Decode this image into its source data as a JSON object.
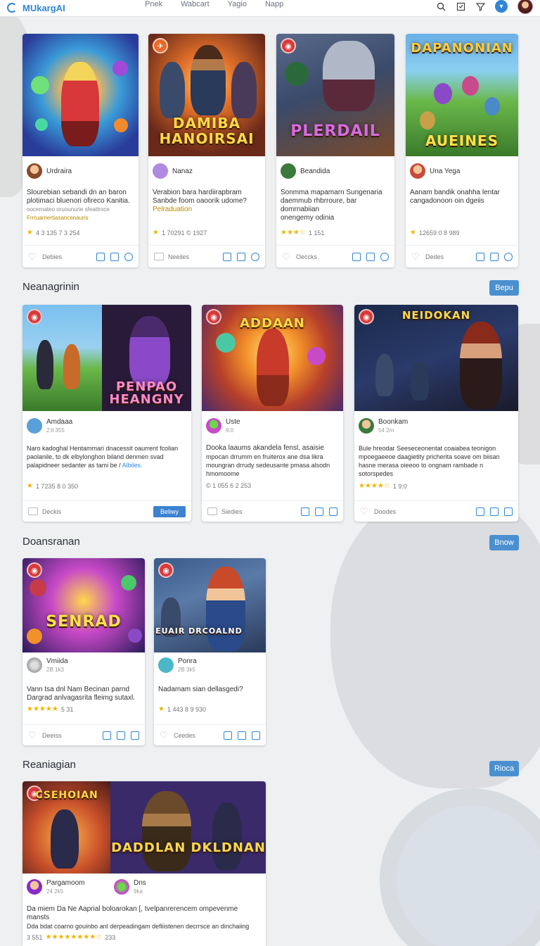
{
  "header": {
    "logo_text": "MUkargAI",
    "nav": [
      "Pnek",
      "Wabcart",
      "Yagio",
      "Napp"
    ],
    "icons": [
      "search-icon",
      "bookmark-icon",
      "filter-icon",
      "chevron-down-icon"
    ]
  },
  "featured": {
    "cards": [
      {
        "thumb_title": "",
        "author": "Urdraira",
        "desc": [
          "Slourebian sebandi dn an baron",
          "plotimaci bluenori ofireco Kanitia."
        ],
        "desc_extra": "oocernateo oruounurie sfeattroce",
        "desc_hl": "Frrruarnertiasancenauris",
        "stats": "4 3 135  7 3 254",
        "foot": "Debies"
      },
      {
        "thumb_title": "DAMIBA HANOIRSAI",
        "author": "Nanaz",
        "desc": [
          "Verabion bara hardiirapbram",
          "Sanbde foom oaoorik udome?"
        ],
        "desc_hl": "Pelraduation",
        "stats": "1 70291  ©  1927",
        "foot": "Neeiles"
      },
      {
        "thumb_title": "PLERDAIL",
        "author": "Beandida",
        "desc": [
          "Sonmma mapamarn Sungenaria",
          "daemmub rhbrroure, bar domrnabiian",
          "onengemy odinia"
        ],
        "stats": "1 151",
        "foot": "Oeccks"
      },
      {
        "thumb_title": "DAPANONIAN",
        "thumb_sub": "AUEINES",
        "author": "Una Yega",
        "desc": [
          "Aanam bandik onahha lentar",
          "cangadonoon oin dgeiis"
        ],
        "stats": "12659 0  8  989",
        "foot": "Dedes"
      }
    ]
  },
  "sections": [
    {
      "title": "Neanagrinin",
      "more": "Bepu",
      "cards": [
        {
          "thumb_title": "PENPAO HEANGNY",
          "author": "Amdaaa",
          "author_sub": "2:ll 355",
          "desc": [
            "Naro kadoghal Hentammari dnacessit oaurrent fcolian",
            "paolanile, to dk elbylonghon biland denmen svad",
            "palapidneer sedanter as tami be / "
          ],
          "desc_link": "Albiles.",
          "stats": "1 7235  8  0 350",
          "foot": "Deckis",
          "play": "Beliwy"
        },
        {
          "thumb_title": "ADDAAN",
          "author": "Uste",
          "author_sub": "9:0",
          "desc": [
            "Dooka laaums akandela fensl, asaisie",
            "mpocan drrumm en fruiterox ane dsa likra",
            "moungran drrudy sedeusante pmasa alsodn",
            "hmomoome"
          ],
          "stats": "© 1 055  6  2 253",
          "foot": "Siedies"
        },
        {
          "thumb_title": "NEIDOKAN",
          "author": "Boonkam",
          "author_sub": "54 2m",
          "desc": [
            "Bule hreodar Seeseceonentat coaiabea teonigon",
            "mpoegaeeoe daagietity pricherita soave om biisan",
            "hasne merasa oieeoo to ongnam rambade n",
            "sotorspedes"
          ],
          "stats": "1 9:0",
          "foot": "Doodes"
        }
      ]
    },
    {
      "title": "Doansranan",
      "more": "Bnow",
      "cards": [
        {
          "thumb_title": "SENRAD",
          "author": "Vmiida",
          "author_sub": "2B 1k3",
          "desc": [
            "Vann tsa dnl Nam Becinan parnd",
            "Dargrad anlvagasrita fleimg sutaxl."
          ],
          "stats": "5 31",
          "foot": "Deeiss"
        },
        {
          "thumb_title": "SEUAIR DRCOALND",
          "author": "Ponra",
          "author_sub": "2B 3k5",
          "desc": [
            "Nadamam sian dellasgedi?"
          ],
          "stats": "1 443  8  9  930",
          "foot": "Ceedes"
        }
      ]
    },
    {
      "title": "Reaniagian",
      "more": "Rioca",
      "cards": [
        {
          "thumb_title": "CSEHOIAN",
          "thumb2_title": "DADDLAN DKLDNAN",
          "author": "Pargamoom",
          "author_sub": "24 2k5",
          "author2": "Dns",
          "author2_sub": "9ka",
          "desc": [
            "Da miem Da Ne Aaprial boloarokan [,  tvelpanrerencem ompevenme mansts",
            "Dda bdat coarno gouinbo anl derpeadingam defiiistenen decrrsce an dinchaiing"
          ],
          "stats": "3 551",
          "stats2": "233"
        }
      ]
    }
  ],
  "colors": {
    "accent": "#2f86d6",
    "button": "#4a90d0",
    "star": "#f0b400",
    "badge": "#e0453a"
  }
}
